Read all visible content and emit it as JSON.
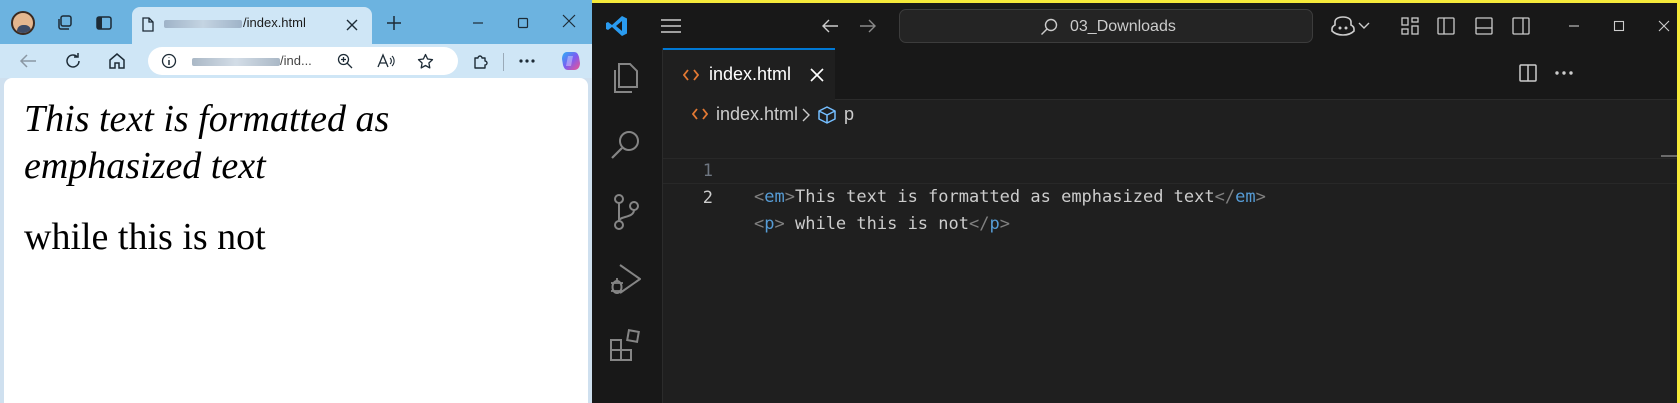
{
  "browser": {
    "tab": {
      "title_suffix": "/index.html",
      "close_icon": "close-icon"
    },
    "addressbar": {
      "url_suffix": "/ind..."
    },
    "page": {
      "em_text": "This text is formatted as emphasized text",
      "p_text": "while this is not"
    },
    "icons": [
      "avatar",
      "workspaces-icon",
      "tab-actions-icon",
      "page-icon",
      "close-icon",
      "new-tab-icon",
      "minimize-icon",
      "maximize-icon",
      "back-icon",
      "refresh-icon",
      "home-icon",
      "site-info-icon",
      "zoom-icon",
      "read-aloud-icon",
      "favorite-icon",
      "extensions-icon",
      "more-icon",
      "copilot-icon"
    ]
  },
  "vscode": {
    "command_center": {
      "label": "03_Downloads"
    },
    "editor_tab": {
      "label": "index.html"
    },
    "breadcrumb": {
      "file": "index.html",
      "symbol": "p"
    },
    "code": {
      "line1": {
        "number": "1",
        "open_lt": "<",
        "open_tag": "em",
        "open_gt": ">",
        "text": "This text is formatted as emphasized text",
        "close_lt": "</",
        "close_tag": "em",
        "close_gt": ">"
      },
      "line2": {
        "number": "2",
        "open_lt": "<",
        "open_tag": "p",
        "open_gt": ">",
        "text": " while this is not",
        "close_lt": "</",
        "close_tag": "p",
        "close_gt": ">"
      }
    },
    "colors": {
      "accent": "#0078d4",
      "tag": "#569cd6",
      "punct": "#808080",
      "html_icon": "#e37933",
      "background": "#1f1f1f",
      "chrome": "#181818"
    }
  },
  "desktop": {
    "colors": {
      "background": "#f5e93a",
      "browser_tabstrip": "#6cb3e0",
      "browser_toolbar": "#cfe6f6"
    }
  }
}
